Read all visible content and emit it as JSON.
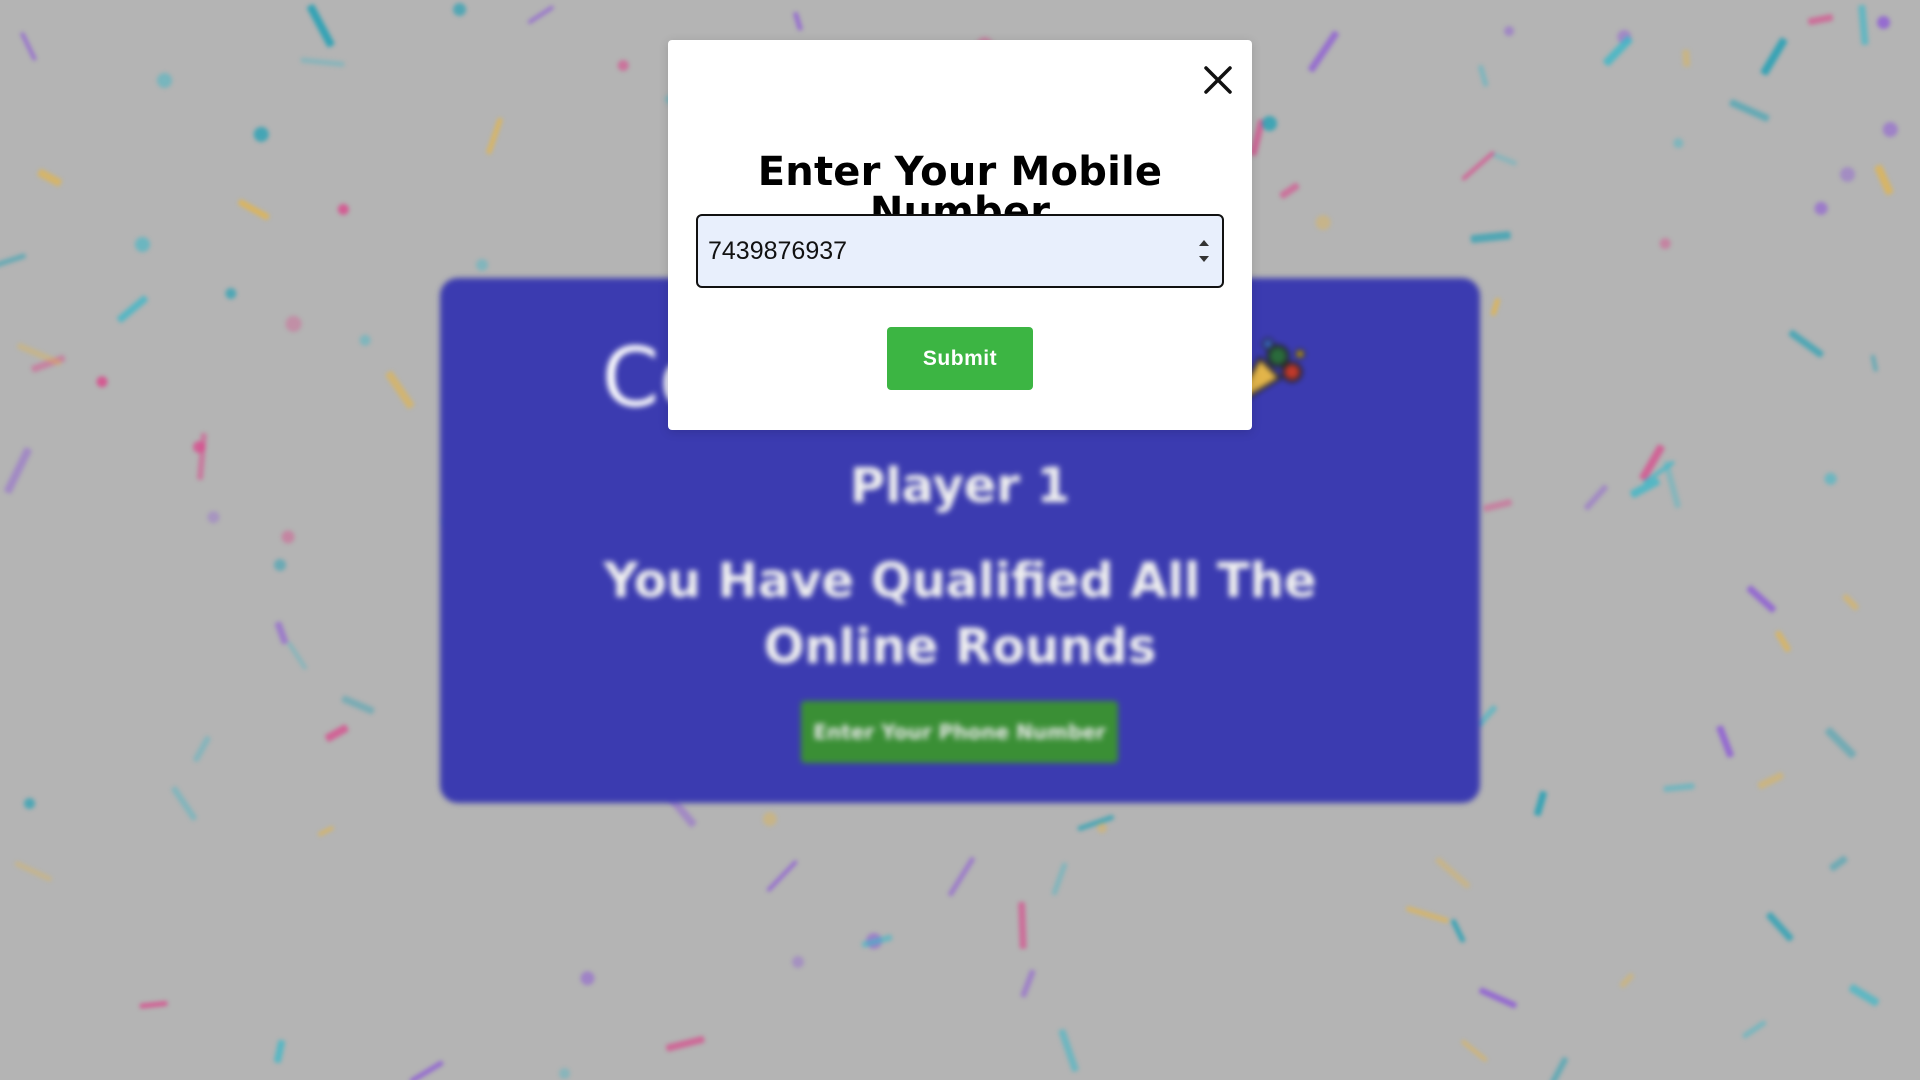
{
  "background": {
    "card": {
      "heading": "Co",
      "player": "Player 1",
      "message": "You Have Qualified All The Online Rounds",
      "button_label": "Enter Your Phone Number"
    },
    "colors": {
      "overlay": "#b4b4b4",
      "card": "#3b3bb0",
      "card_button": "#3a8f35"
    },
    "confetti_colors": [
      "#3bb8c8",
      "#d94a8c",
      "#8e5bd6",
      "#e3b54a",
      "#1fa0b5"
    ]
  },
  "modal": {
    "close_icon": "close-icon",
    "title": "Enter Your Mobile Number",
    "phone_input": {
      "value": "7439876937",
      "type": "number"
    },
    "submit_label": "Submit",
    "colors": {
      "submit": "#3cb543",
      "input_bg": "#e8effc"
    }
  }
}
